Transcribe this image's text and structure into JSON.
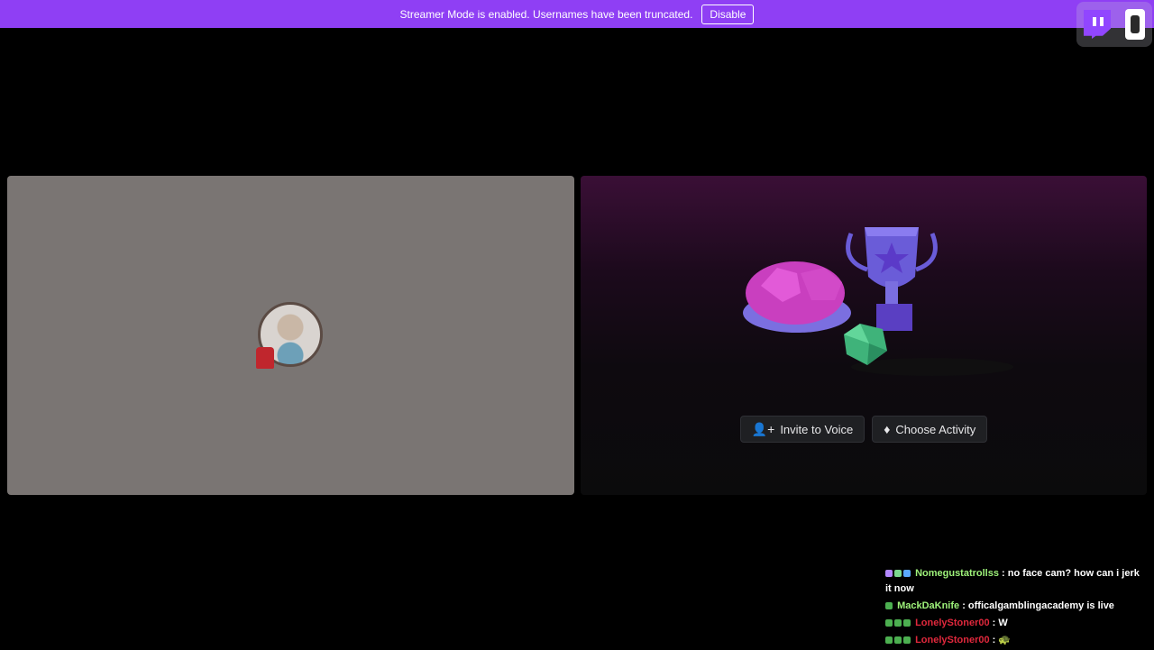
{
  "banner": {
    "message": "Streamer Mode is enabled. Usernames have been truncated.",
    "disable_label": "Disable",
    "color": "#8f3ff4"
  },
  "widget": {
    "icons": [
      "twitch-logo",
      "counter-icon"
    ]
  },
  "voice": {
    "invite_label": "Invite to Voice",
    "activity_label": "Choose Activity",
    "invite_icon": "add-user-icon",
    "activity_icon": "activity-icon"
  },
  "chat": [
    {
      "user": "Nomegustatrollss",
      "user_color": "#9ef27a",
      "badges": [
        "#b388ff",
        "#7bd88f",
        "#5aa9ff"
      ],
      "sep": " : ",
      "message": "no face cam? how can i jerk it now"
    },
    {
      "user": "MackDaKnife",
      "user_color": "#9ef27a",
      "badges": [
        "#4caf50"
      ],
      "sep": " : ",
      "message": "officalgamblingacademy is live"
    },
    {
      "user": "LonelyStoner00",
      "user_color": "#e0283c",
      "badges": [
        "#4caf50",
        "#4caf50",
        "#4caf50"
      ],
      "sep": " : ",
      "message": "W"
    },
    {
      "user": "LonelyStoner00",
      "user_color": "#e0283c",
      "badges": [
        "#4caf50",
        "#4caf50",
        "#4caf50"
      ],
      "sep": " : ",
      "message": "🐢"
    }
  ]
}
